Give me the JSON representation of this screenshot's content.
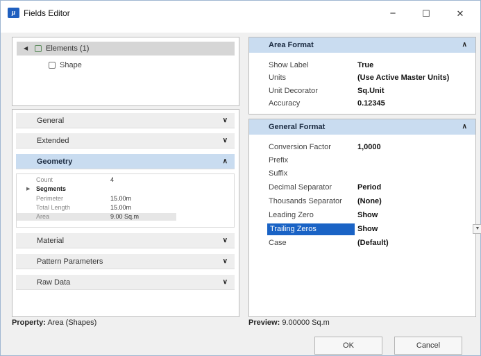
{
  "window": {
    "title": "Fields Editor",
    "minimize": "−",
    "maximize": "☐",
    "close": "✕",
    "accent": "#1f5fbf"
  },
  "tree": {
    "root_label": "Elements (1)",
    "child_label": "Shape"
  },
  "sections": {
    "general": "General",
    "extended": "Extended",
    "geometry": "Geometry",
    "material": "Material",
    "pattern": "Pattern Parameters",
    "raw": "Raw Data"
  },
  "geometry_rows": [
    {
      "label": "Count",
      "value": "4"
    },
    {
      "label": "Segments",
      "value": ""
    },
    {
      "label": "Perimeter",
      "value": "15.00m"
    },
    {
      "label": "Total Length",
      "value": "15.00m"
    },
    {
      "label": "Area",
      "value": "9.00 Sq.m"
    }
  ],
  "area_format": {
    "header": "Area Format",
    "rows": [
      {
        "label": "Show Label",
        "value": "True"
      },
      {
        "label": "Units",
        "value": "(Use Active Master Units)"
      },
      {
        "label": "Unit Decorator",
        "value": "Sq.Unit"
      },
      {
        "label": "Accuracy",
        "value": "0.12345"
      }
    ]
  },
  "general_format": {
    "header": "General Format",
    "rows": [
      {
        "label": "Conversion Factor",
        "value": "1,0000"
      },
      {
        "label": "Prefix",
        "value": ""
      },
      {
        "label": "Suffix",
        "value": ""
      },
      {
        "label": "Decimal Separator",
        "value": "Period"
      },
      {
        "label": "Thousands Separator",
        "value": "(None)"
      },
      {
        "label": "Leading Zero",
        "value": "Show"
      },
      {
        "label": "Trailing Zeros",
        "value": "Show"
      },
      {
        "label": "Case",
        "value": "(Default)"
      }
    ]
  },
  "footer": {
    "property_label": "Property:",
    "property_value": "Area (Shapes)",
    "preview_label": "Preview:",
    "preview_value": "9.00000 Sq.m",
    "ok": "OK",
    "cancel": "Cancel"
  }
}
